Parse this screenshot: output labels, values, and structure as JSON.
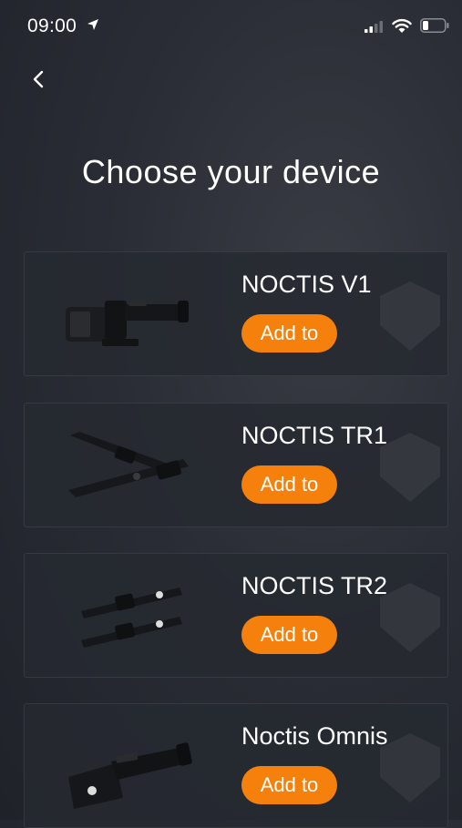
{
  "status_bar": {
    "time": "09:00"
  },
  "header": {
    "title": "Choose your device"
  },
  "devices": [
    {
      "name": "NOCTIS V1",
      "button_label": "Add to"
    },
    {
      "name": "NOCTIS TR1",
      "button_label": "Add to"
    },
    {
      "name": "NOCTIS TR2",
      "button_label": "Add to"
    },
    {
      "name": "Noctis Omnis",
      "button_label": "Add to"
    }
  ],
  "colors": {
    "accent": "#f5800b",
    "background": "#2a2d35",
    "card": "#262930"
  }
}
